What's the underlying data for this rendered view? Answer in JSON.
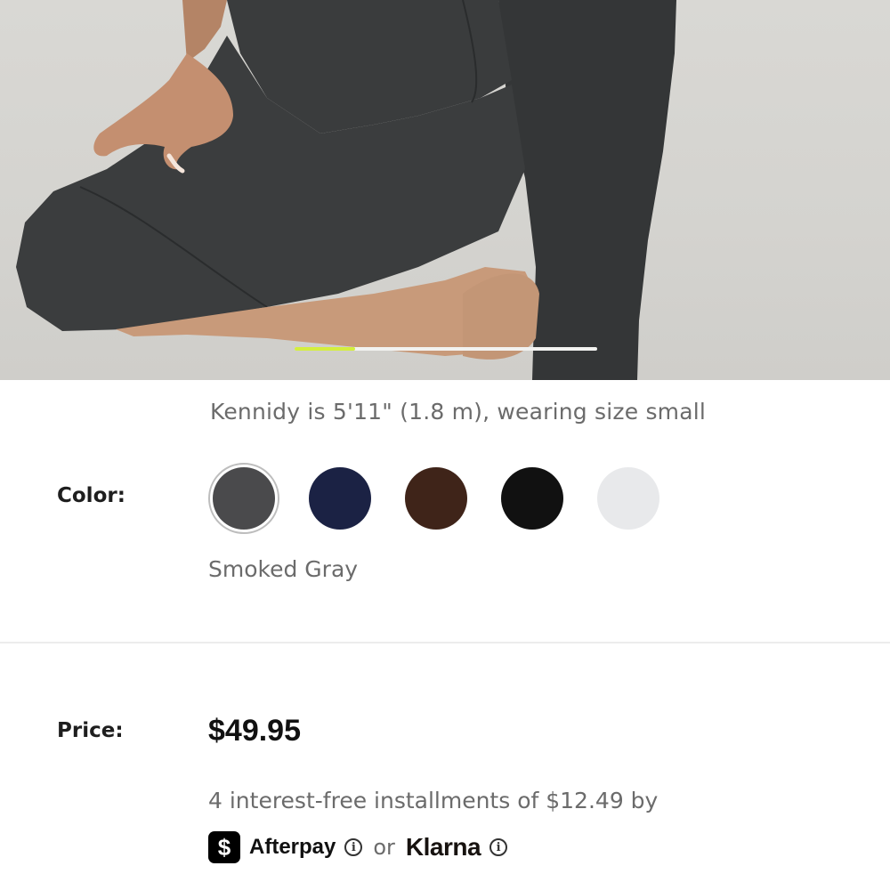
{
  "gallery": {
    "image_alt": "Model wearing smoked gray leggings",
    "progress": 0.2
  },
  "caption": "Kennidy is 5'11\" (1.8 m), wearing size small",
  "color": {
    "label": "Color:",
    "selected_name": "Smoked Gray",
    "swatches": [
      {
        "name": "smoked-gray",
        "hex": "#4a4a4c",
        "selected": true
      },
      {
        "name": "navy",
        "hex": "#1b2244",
        "selected": false
      },
      {
        "name": "brown",
        "hex": "#3f2419",
        "selected": false
      },
      {
        "name": "black",
        "hex": "#111111",
        "selected": false
      },
      {
        "name": "white",
        "hex": "#e8e9eb",
        "selected": false
      }
    ]
  },
  "price": {
    "label": "Price:",
    "amount": "$49.95",
    "installments": "4 interest-free installments of $12.49 by",
    "afterpay_badge": "$",
    "afterpay": "Afterpay",
    "or": "or",
    "klarna": "Klarna",
    "info_glyph": "i"
  }
}
